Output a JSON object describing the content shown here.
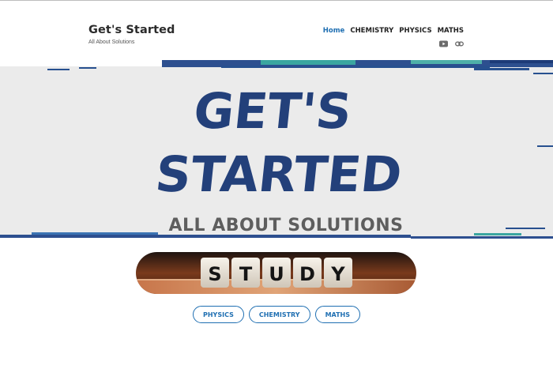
{
  "site": {
    "title": "Get's Started",
    "tagline": "All About Solutions"
  },
  "nav": {
    "items": [
      "Home",
      "CHEMISTRY",
      "PHYSICS",
      "MATHS"
    ],
    "active_index": 0
  },
  "social": {
    "icons": [
      "youtube-icon",
      "link-icon"
    ]
  },
  "banner": {
    "line1": "GET'S",
    "line2": "STARTED",
    "subtitle": "ALL ABOUT SOLUTIONS"
  },
  "study_image": {
    "dice_letters": [
      "S",
      "T",
      "U",
      "D",
      "Y"
    ]
  },
  "buttons": [
    "PHYSICS",
    "CHEMISTRY",
    "MATHS"
  ],
  "colors": {
    "accent": "#1f6fb2",
    "banner_text": "#23407a",
    "banner_subtitle": "#5e5e5e",
    "banner_bg": "#ebebeb"
  }
}
